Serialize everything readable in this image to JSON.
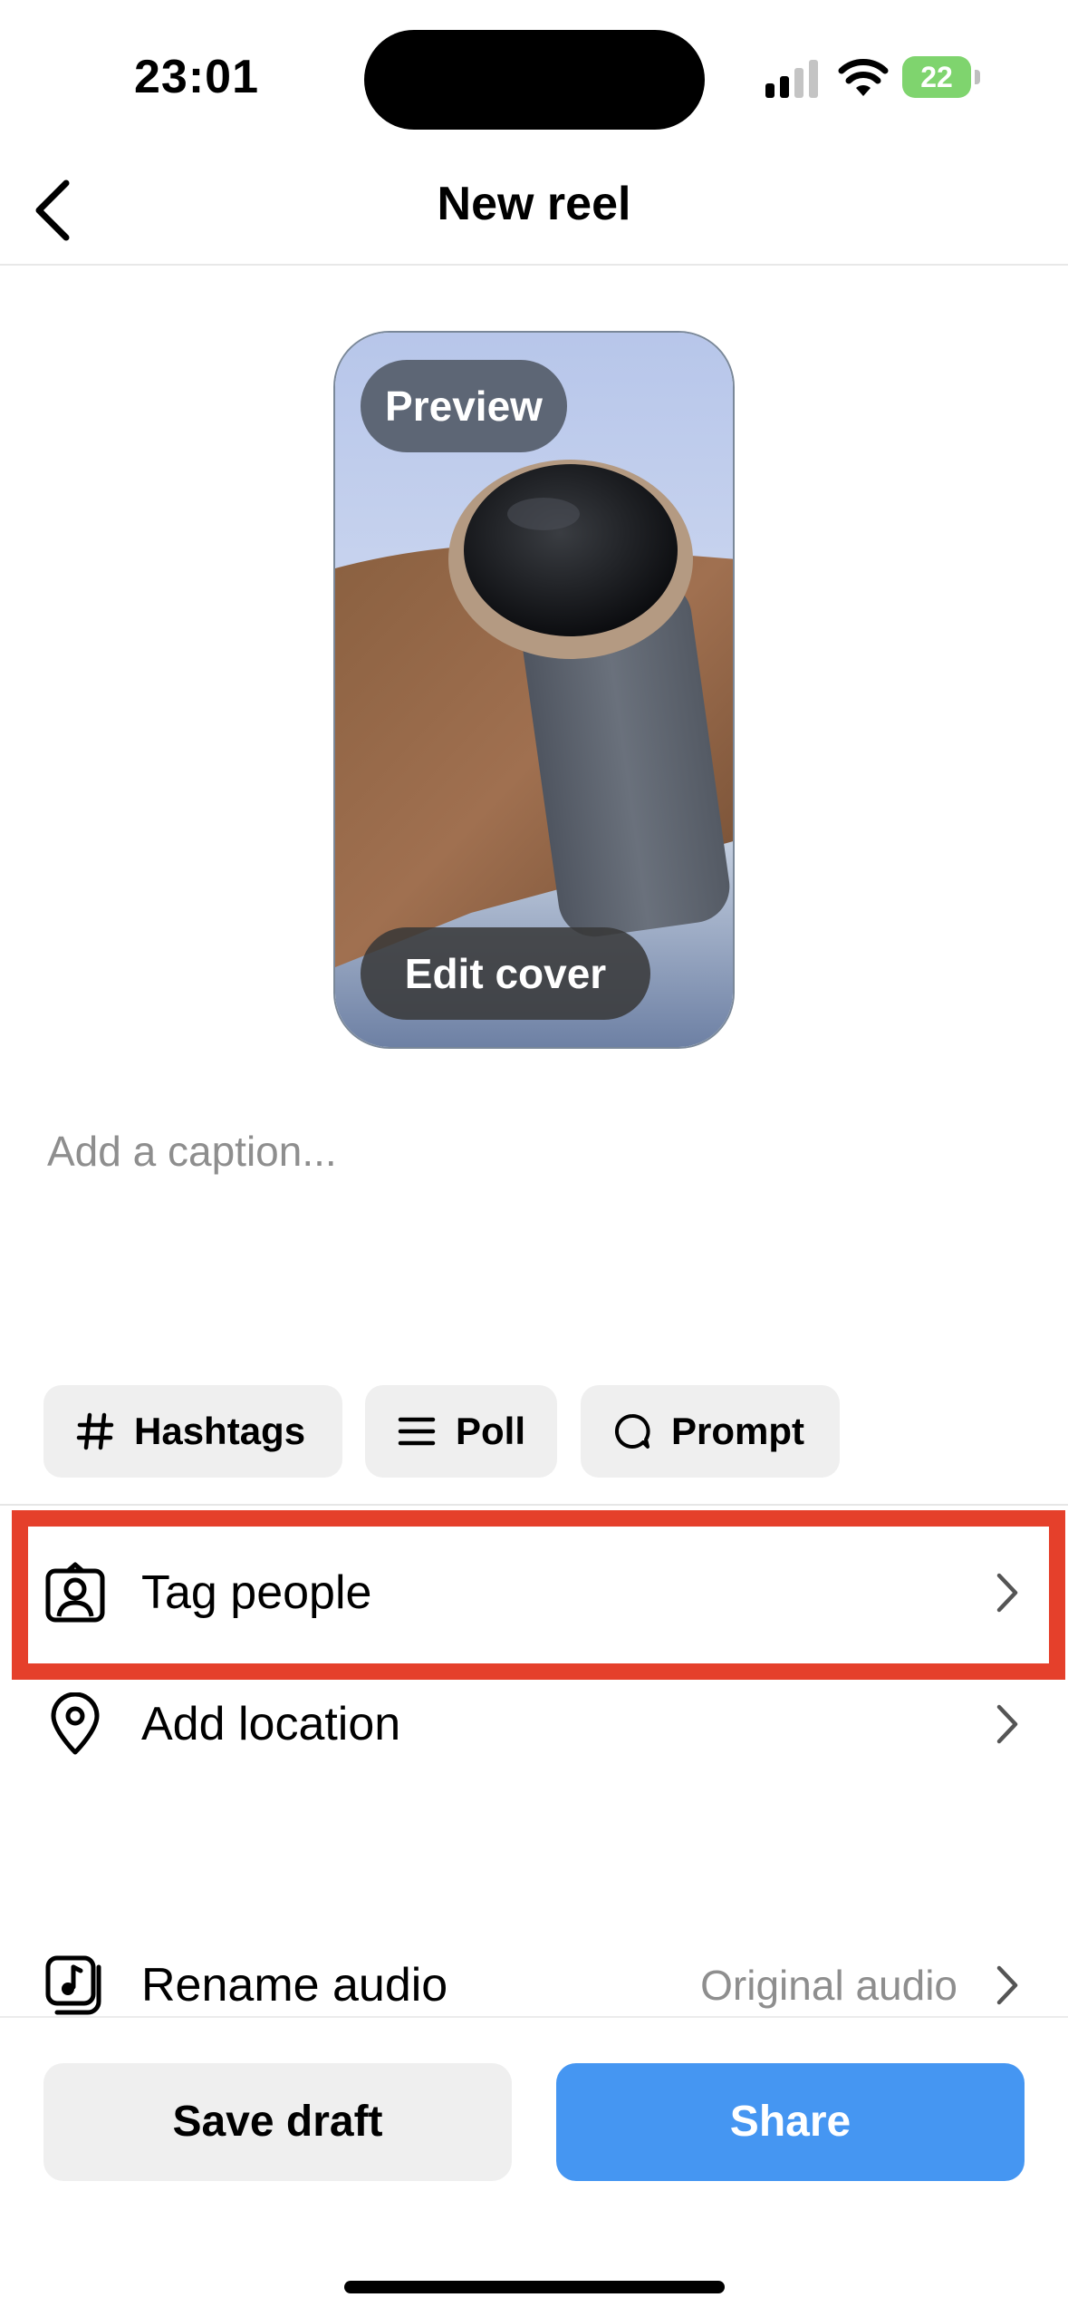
{
  "status_bar": {
    "time": "23:01",
    "battery_level": "22",
    "icons": [
      "signal-icon",
      "wifi-icon",
      "battery-icon"
    ],
    "battery_color": "#7fd46e"
  },
  "header": {
    "title": "New reel",
    "back_icon": "chevron-left-icon"
  },
  "preview": {
    "preview_label": "Preview",
    "edit_cover_label": "Edit cover"
  },
  "caption": {
    "placeholder": "Add a caption..."
  },
  "chips": [
    {
      "label": "Hashtags",
      "icon": "hashtag-icon"
    },
    {
      "label": "Poll",
      "icon": "list-icon"
    },
    {
      "label": "Prompt",
      "icon": "speech-bubble-icon"
    }
  ],
  "rows": {
    "tag_people": {
      "label": "Tag people",
      "icon": "tag-person-icon"
    },
    "add_location": {
      "label": "Add location",
      "icon": "location-pin-icon"
    },
    "rename_audio": {
      "label": "Rename audio",
      "value": "Original audio",
      "icon": "music-note-icon"
    }
  },
  "actions": {
    "save_draft": "Save draft",
    "share": "Share"
  },
  "colors": {
    "accent": "#4596f2",
    "highlight": "#e5402b",
    "chip_bg": "#efefef"
  }
}
